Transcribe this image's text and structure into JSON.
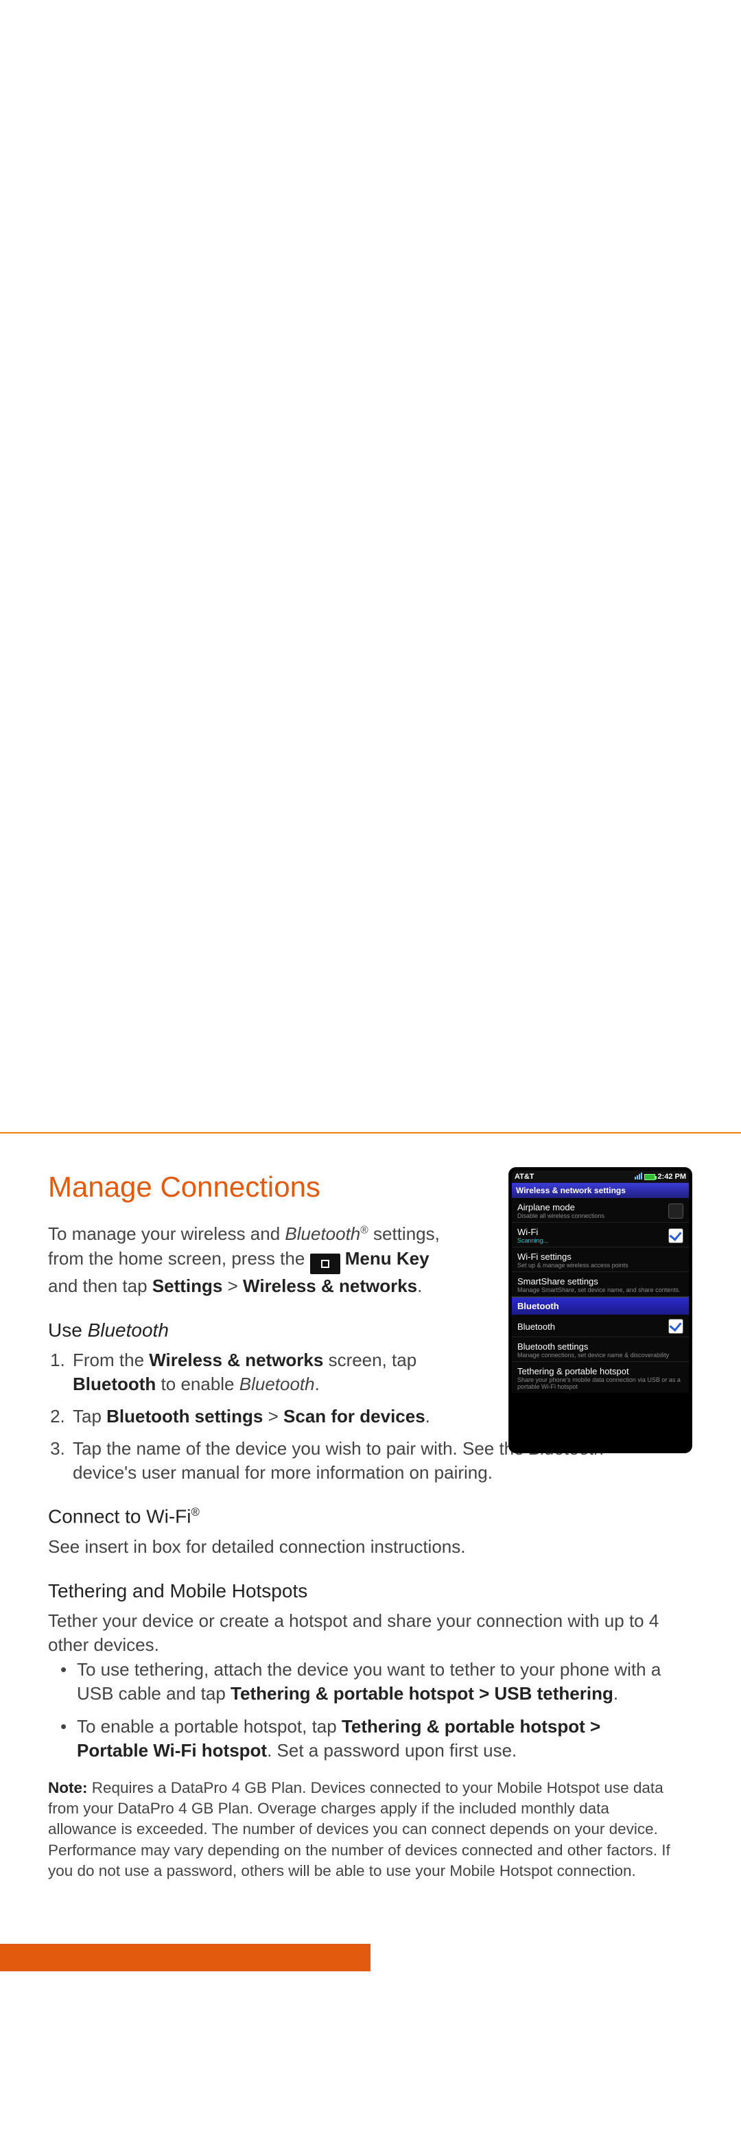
{
  "headline": "Manage Connections",
  "intro": {
    "p1a": "To manage your wireless and ",
    "p1b": "Bluetooth",
    "p1c": " settings, from the home screen, press the ",
    "menu": "Menu Key",
    "p1d": " and then tap ",
    "s1": "Settings",
    "gt": " > ",
    "s2": "Wireless & networks",
    "dot": "."
  },
  "s_bt": {
    "h": "Use ",
    "hi": "Bluetooth",
    "li1a": "From the ",
    "li1b": "Wireless & networks",
    "li1c": " screen, tap ",
    "li1d": "Bluetooth",
    "li1e": " to enable ",
    "li1f": "Bluetooth",
    "li1g": ".",
    "li2a": "Tap ",
    "li2b": "Bluetooth settings",
    "li2c": " > ",
    "li2d": "Scan for devices",
    "li2e": ".",
    "li3a": "Tap the name of the device you wish to pair with. See the ",
    "li3b": "Bluetooth",
    "li3c": " device's user manual for more information on pairing."
  },
  "s_wifi": {
    "h": "Connect to Wi-Fi",
    "sup": "®",
    "p": "See insert in box for detailed connection instructions."
  },
  "s_teth": {
    "h": "Tethering and Mobile Hotspots",
    "p": "Tether your device or create a hotspot and share your connection with up to 4 other devices.",
    "b1a": "To use tethering, attach the device you want to tether to your phone with a USB cable and tap ",
    "b1b": "Tethering & portable hotspot > USB tethering",
    "b1c": ".",
    "b2a": "To enable a portable hotspot, tap ",
    "b2b": "Tethering & portable hotspot > Portable Wi-Fi hotspot",
    "b2c": ". Set a password upon first use."
  },
  "note": {
    "label": "Note:",
    "text": " Requires a DataPro 4 GB Plan. Devices connected to your Mobile Hotspot use data from your DataPro 4 GB Plan. Overage charges apply if the included monthly data allowance is exceeded. The number of devices you can connect depends on your device. Performance may vary depending on the number of devices connected and other factors. If you do not use a password, others will be able to use your Mobile Hotspot connection."
  },
  "phone": {
    "carrier": "AT&T",
    "time": "2:42 PM",
    "header": "Wireless & network settings",
    "rows": [
      {
        "t": "Airplane mode",
        "s": "Disable all wireless connections",
        "cb": false,
        "sub_style": "gray"
      },
      {
        "t": "Wi-Fi",
        "s": "Scanning...",
        "cb": true,
        "sub_style": "teal"
      },
      {
        "t": "Wi-Fi settings",
        "s": "Set up & manage wireless access points",
        "sub_style": "gray"
      },
      {
        "t": "SmartShare settings",
        "s": "Manage SmartShare, set device name, and share contents.",
        "sub_style": "gray"
      }
    ],
    "section": "Bluetooth",
    "rows2": [
      {
        "t": "Bluetooth",
        "s": "",
        "cb": true
      },
      {
        "t": "Bluetooth settings",
        "s": "Manage connections, set device name & discoverability",
        "sub_style": "gray"
      },
      {
        "t": "Tethering & portable hotspot",
        "s": "Share your phone's mobile data connection via USB or as a portable Wi-Fi hotspot",
        "sub_style": "gray"
      }
    ]
  }
}
